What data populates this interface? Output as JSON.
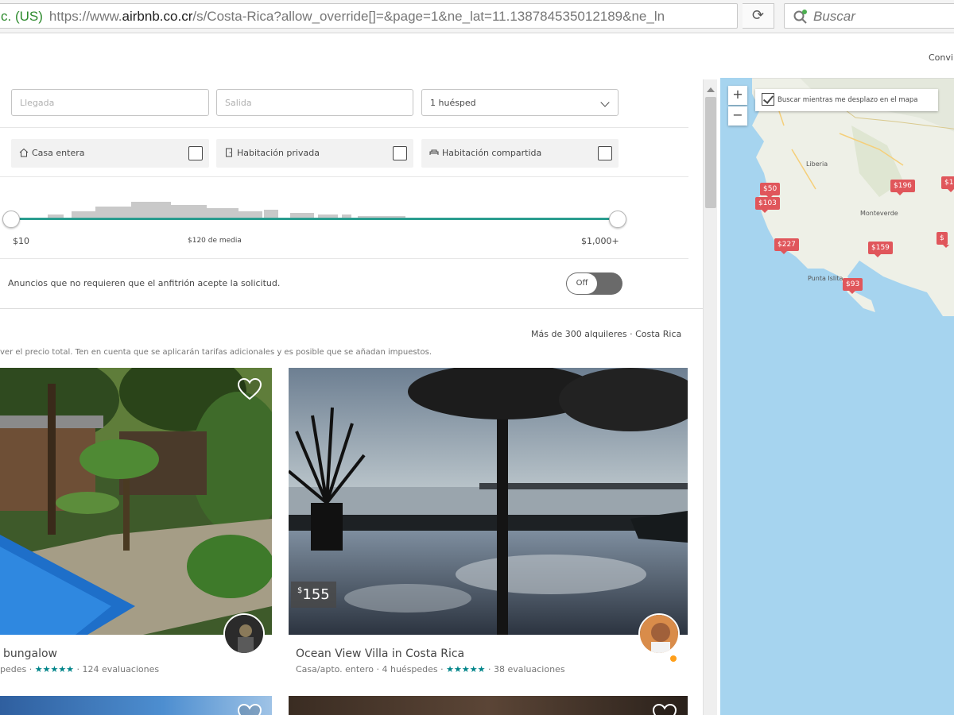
{
  "browser": {
    "ev_label": "c. (US)",
    "url_prefix": "https://www.",
    "url_domain": "airbnb.co.cr",
    "url_rest": "/s/Costa-Rica?allow_override[]=&page=1&ne_lat=11.138784535012189&ne_ln",
    "search_placeholder": "Buscar"
  },
  "header": {
    "top_right_link": "Convi"
  },
  "filters": {
    "checkin_placeholder": "Llegada",
    "checkout_placeholder": "Salida",
    "guests_value": "1 huésped",
    "room_types": [
      {
        "label": "Casa entera",
        "icon": "home-icon",
        "checked": false
      },
      {
        "label": "Habitación privada",
        "icon": "door-icon",
        "checked": false
      },
      {
        "label": "Habitación compartida",
        "icon": "shared-room-icon",
        "checked": false
      }
    ],
    "price": {
      "min_label": "$10",
      "avg_label": "$120 de media",
      "max_label": "$1,000+"
    },
    "instant_book_label": "Anuncios que no requieren que el anfitrión acepte la solicitud.",
    "instant_book_toggle": "Off"
  },
  "results": {
    "count_label": "Más de 300 alquileres · Costa Rica",
    "notice": "ver el precio total. Ten en cuenta que se aplicarán tarifas adicionales y es posible que se añadan impuestos."
  },
  "listings": [
    {
      "title": "bungalow",
      "meta_prefix": "pedes ·",
      "stars": "★★★★★",
      "reviews": "124 evaluaciones"
    },
    {
      "price_symbol": "$",
      "price": "155",
      "title": "Ocean View Villa in Costa Rica",
      "meta_prefix": "Casa/apto. entero · 4 huéspedes ·",
      "stars": "★★★★★",
      "reviews": "38 evaluaciones"
    }
  ],
  "map": {
    "search_as_move_label": "Buscar mientras me desplazo en el mapa",
    "zoom_in": "+",
    "zoom_out": "−",
    "pins": [
      "$50",
      "$103",
      "$196",
      "$1",
      "$227",
      "$159",
      "$93",
      "$"
    ],
    "places": [
      "Liberia",
      "Monteverde",
      "Punta Islita"
    ]
  },
  "colors": {
    "accent_teal": "#2a9d8f",
    "pin_red": "#e0565b",
    "water": "#a6d4ef",
    "land": "#eef0e7"
  }
}
